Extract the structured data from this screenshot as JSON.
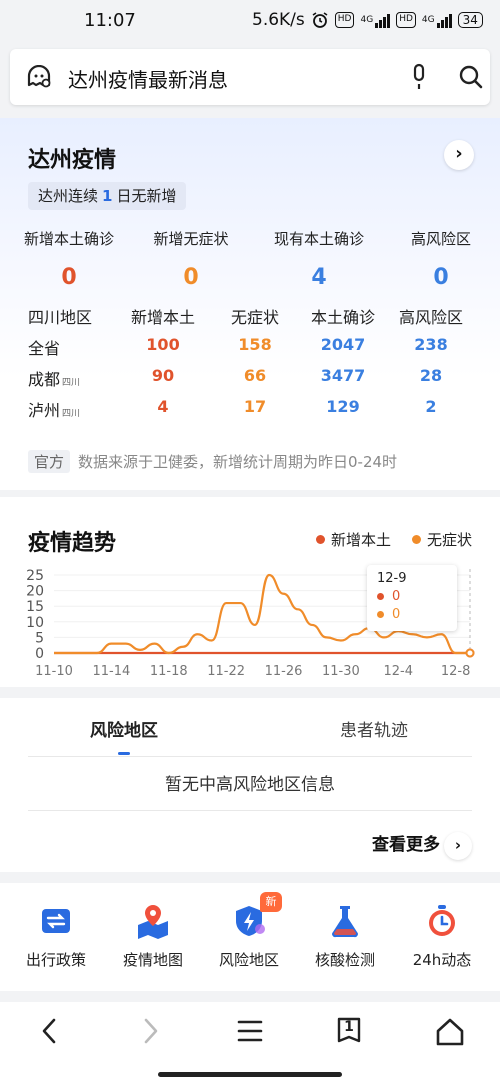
{
  "status_bar": {
    "time": "11:07",
    "speed": "5.6K/s",
    "hd1": "HD",
    "net1": "4G",
    "hd2": "HD",
    "net2": "4G",
    "battery": "34"
  },
  "search": {
    "query": "达州疫情最新消息"
  },
  "summary": {
    "title": "达州疫情",
    "more": "›",
    "streak_prefix": "达州连续",
    "streak_days": "1",
    "streak_suffix": "日无新增",
    "stats": [
      {
        "label": "新增本土确诊",
        "value": "0",
        "color": "#e0532c"
      },
      {
        "label": "新增无症状",
        "value": "0",
        "color": "#f08c2a"
      },
      {
        "label": "现有本土确诊",
        "value": "4",
        "color": "#3a7fe0"
      },
      {
        "label": "高风险区",
        "value": "0",
        "color": "#3a7fe0"
      }
    ],
    "table": {
      "headers": [
        "四川地区",
        "新增本土",
        "无症状",
        "本土确诊",
        "高风险区"
      ],
      "rows": [
        {
          "region": "全省",
          "sub": "",
          "new_local": "100",
          "asymptomatic": "158",
          "confirmed": "2047",
          "high_risk": "238"
        },
        {
          "region": "成都",
          "sub": "四川",
          "new_local": "90",
          "asymptomatic": "66",
          "confirmed": "3477",
          "high_risk": "28"
        },
        {
          "region": "泸州",
          "sub": "四川",
          "new_local": "4",
          "asymptomatic": "17",
          "confirmed": "129",
          "high_risk": "2"
        }
      ]
    },
    "source_badge": "官方",
    "source_text": "数据来源于卫健委，新增统计周期为昨日0-24时"
  },
  "trend": {
    "title": "疫情趋势",
    "legend": [
      {
        "name": "新增本土",
        "color": "#e0532c"
      },
      {
        "name": "无症状",
        "color": "#f08c2a"
      }
    ],
    "tooltip": {
      "date": "12-9",
      "new_local": "0",
      "asymptomatic": "0"
    }
  },
  "chart_data": {
    "type": "line",
    "title": "疫情趋势",
    "x_tick_labels": [
      "11-10",
      "11-14",
      "11-18",
      "11-22",
      "11-26",
      "11-30",
      "12-4",
      "12-8"
    ],
    "y_tick_labels": [
      "25",
      "20",
      "15",
      "10",
      "5",
      "0"
    ],
    "ylim": [
      0,
      25
    ],
    "x": [
      "11-10",
      "11-11",
      "11-12",
      "11-13",
      "11-14",
      "11-15",
      "11-16",
      "11-17",
      "11-18",
      "11-19",
      "11-20",
      "11-21",
      "11-22",
      "11-23",
      "11-24",
      "11-25",
      "11-26",
      "11-27",
      "11-28",
      "11-29",
      "11-30",
      "12-1",
      "12-2",
      "12-3",
      "12-4",
      "12-5",
      "12-6",
      "12-7",
      "12-8",
      "12-9"
    ],
    "series": [
      {
        "name": "新增本土",
        "color": "#e0532c",
        "values": [
          0,
          0,
          0,
          0,
          0,
          0,
          0,
          0,
          0,
          0,
          0,
          0,
          0,
          0,
          0,
          0,
          0,
          0,
          0,
          0,
          0,
          0,
          0,
          0,
          0,
          0,
          0,
          0,
          0,
          0
        ]
      },
      {
        "name": "无症状",
        "color": "#f08c2a",
        "values": [
          0,
          0,
          0,
          0,
          3,
          3,
          1,
          3,
          0,
          2,
          6,
          4,
          16,
          16,
          9,
          25,
          19,
          14,
          9,
          5,
          4,
          6,
          8,
          5,
          7,
          6,
          5,
          6,
          0,
          0
        ]
      }
    ]
  },
  "risk": {
    "tabs": [
      "风险地区",
      "患者轨迹"
    ],
    "empty_text": "暂无中高风险地区信息",
    "see_more": "查看更多",
    "see_more_arrow": "›"
  },
  "tools": [
    {
      "label": "出行政策",
      "icon": "travel-policy-icon"
    },
    {
      "label": "疫情地图",
      "icon": "epidemic-map-icon"
    },
    {
      "label": "风险地区",
      "icon": "risk-area-icon",
      "badge": "新"
    },
    {
      "label": "核酸检测",
      "icon": "nucleic-test-icon"
    },
    {
      "label": "24h动态",
      "icon": "clock-24h-icon"
    }
  ],
  "nav": {
    "tab_count": "1"
  }
}
